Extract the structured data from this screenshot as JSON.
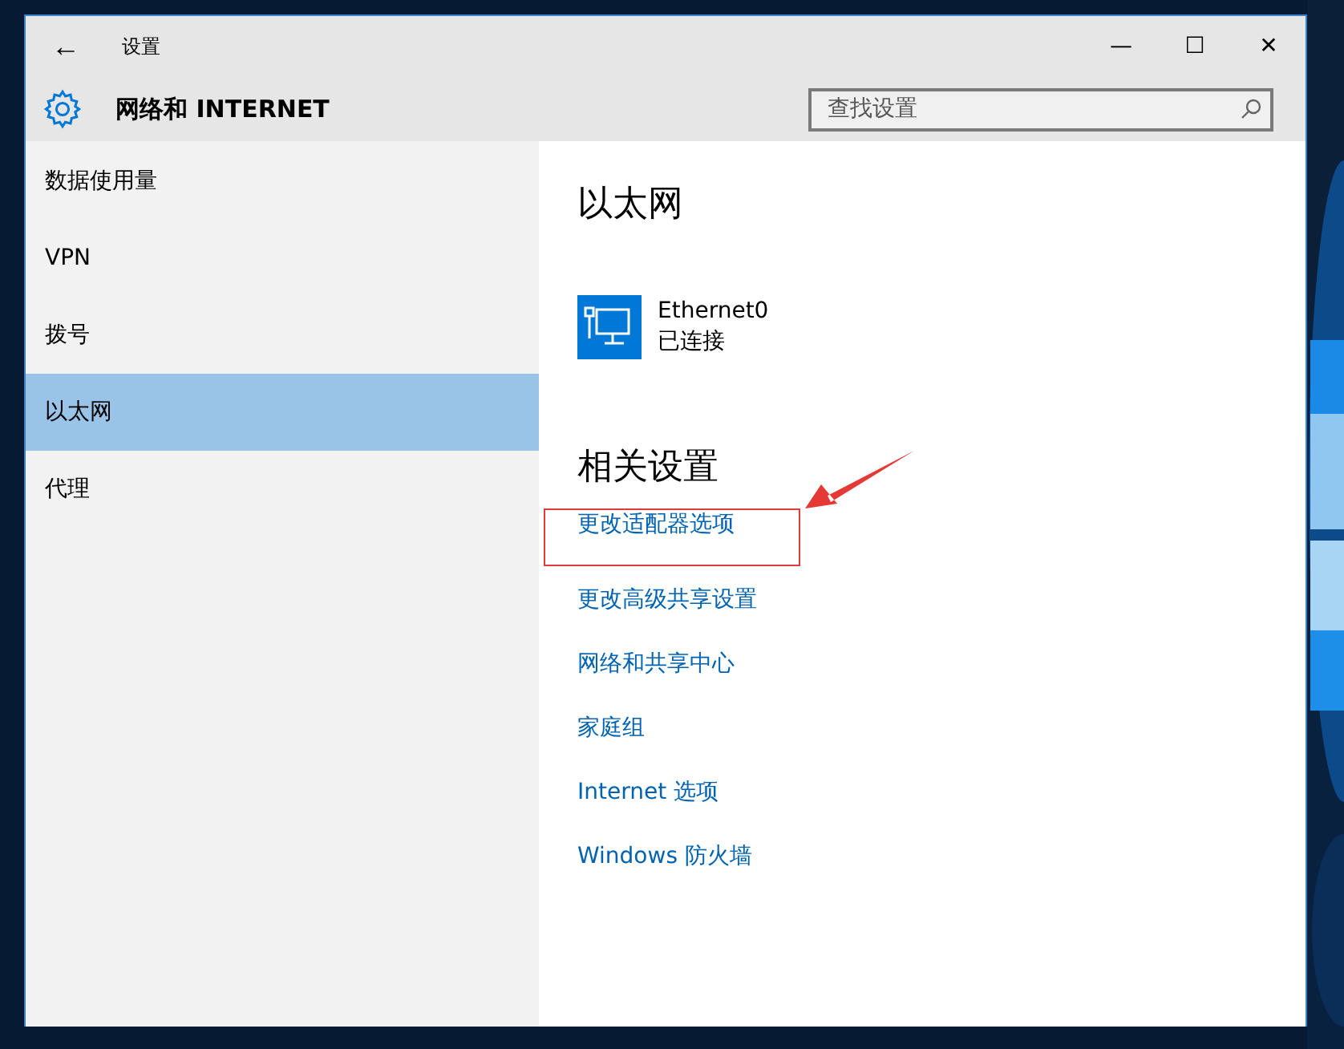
{
  "window": {
    "title": "设置",
    "back": "←",
    "controls": [
      "—",
      "☐",
      "✕"
    ]
  },
  "header": {
    "title": "网络和 INTERNET",
    "search": {
      "placeholder": "查找设置"
    }
  },
  "sidebar": {
    "items": [
      {
        "label": "数据使用量",
        "selected": false
      },
      {
        "label": "VPN",
        "selected": false
      },
      {
        "label": "拨号",
        "selected": false
      },
      {
        "label": "以太网",
        "selected": true
      },
      {
        "label": "代理",
        "selected": false
      }
    ]
  },
  "content": {
    "heading": "以太网",
    "connection": {
      "name": "Ethernet0",
      "status": "已连接"
    },
    "related_heading": "相关设置",
    "links": [
      {
        "label": "更改适配器选项",
        "highlighted": true
      },
      {
        "label": "更改高级共享设置",
        "highlighted": false
      },
      {
        "label": "网络和共享中心",
        "highlighted": false
      },
      {
        "label": "家庭组",
        "highlighted": false
      },
      {
        "label": "Internet 选项",
        "highlighted": false
      },
      {
        "label": "Windows 防火墙",
        "highlighted": false
      }
    ]
  }
}
